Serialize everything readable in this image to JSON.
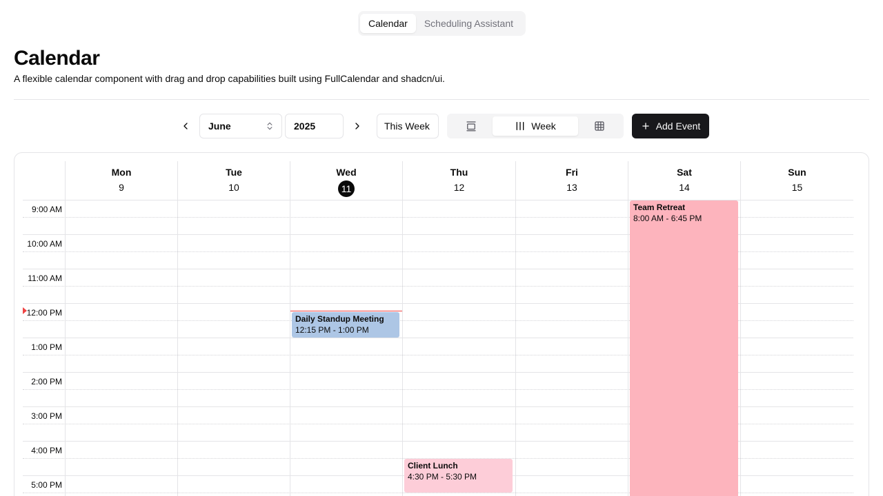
{
  "top_tabs": [
    {
      "label": "Calendar",
      "active": true
    },
    {
      "label": "Scheduling Assistant",
      "active": false
    }
  ],
  "header": {
    "title": "Calendar",
    "description": "A flexible calendar component with drag and drop capabilities built using FullCalendar and shadcn/ui."
  },
  "toolbar": {
    "month": "June",
    "year": "2025",
    "this_week_label": "This Week",
    "views": [
      {
        "icon": "day-view-icon",
        "label": "",
        "active": false
      },
      {
        "icon": "week-view-icon",
        "label": "Week",
        "active": true
      },
      {
        "icon": "month-view-icon",
        "label": "",
        "active": false
      }
    ],
    "add_event_label": "Add Event"
  },
  "days": [
    {
      "name": "Mon",
      "num": "9",
      "today": false
    },
    {
      "name": "Tue",
      "num": "10",
      "today": false
    },
    {
      "name": "Wed",
      "num": "11",
      "today": true
    },
    {
      "name": "Thu",
      "num": "12",
      "today": false
    },
    {
      "name": "Fri",
      "num": "13",
      "today": false
    },
    {
      "name": "Sat",
      "num": "14",
      "today": false
    },
    {
      "name": "Sun",
      "num": "15",
      "today": false
    }
  ],
  "time_slots": [
    "9:00 AM",
    "10:00 AM",
    "11:00 AM",
    "12:00 PM",
    "1:00 PM",
    "2:00 PM",
    "3:00 PM",
    "4:00 PM",
    "5:00 PM"
  ],
  "events": [
    {
      "title": "Team Retreat",
      "time": "8:00 AM - 6:45 PM",
      "day_index": 5,
      "color": "#fdb4bd"
    },
    {
      "title": "Daily Standup Meeting",
      "time": "12:15 PM - 1:00 PM",
      "day_index": 2,
      "color": "#adc6e5"
    },
    {
      "title": "Client Lunch",
      "time": "4:30 PM - 5:30 PM",
      "day_index": 3,
      "color": "#fdcdd8"
    }
  ],
  "colors": {
    "accent": "#18181b",
    "now_indicator": "#ef4444",
    "border": "#e4e4e7"
  }
}
